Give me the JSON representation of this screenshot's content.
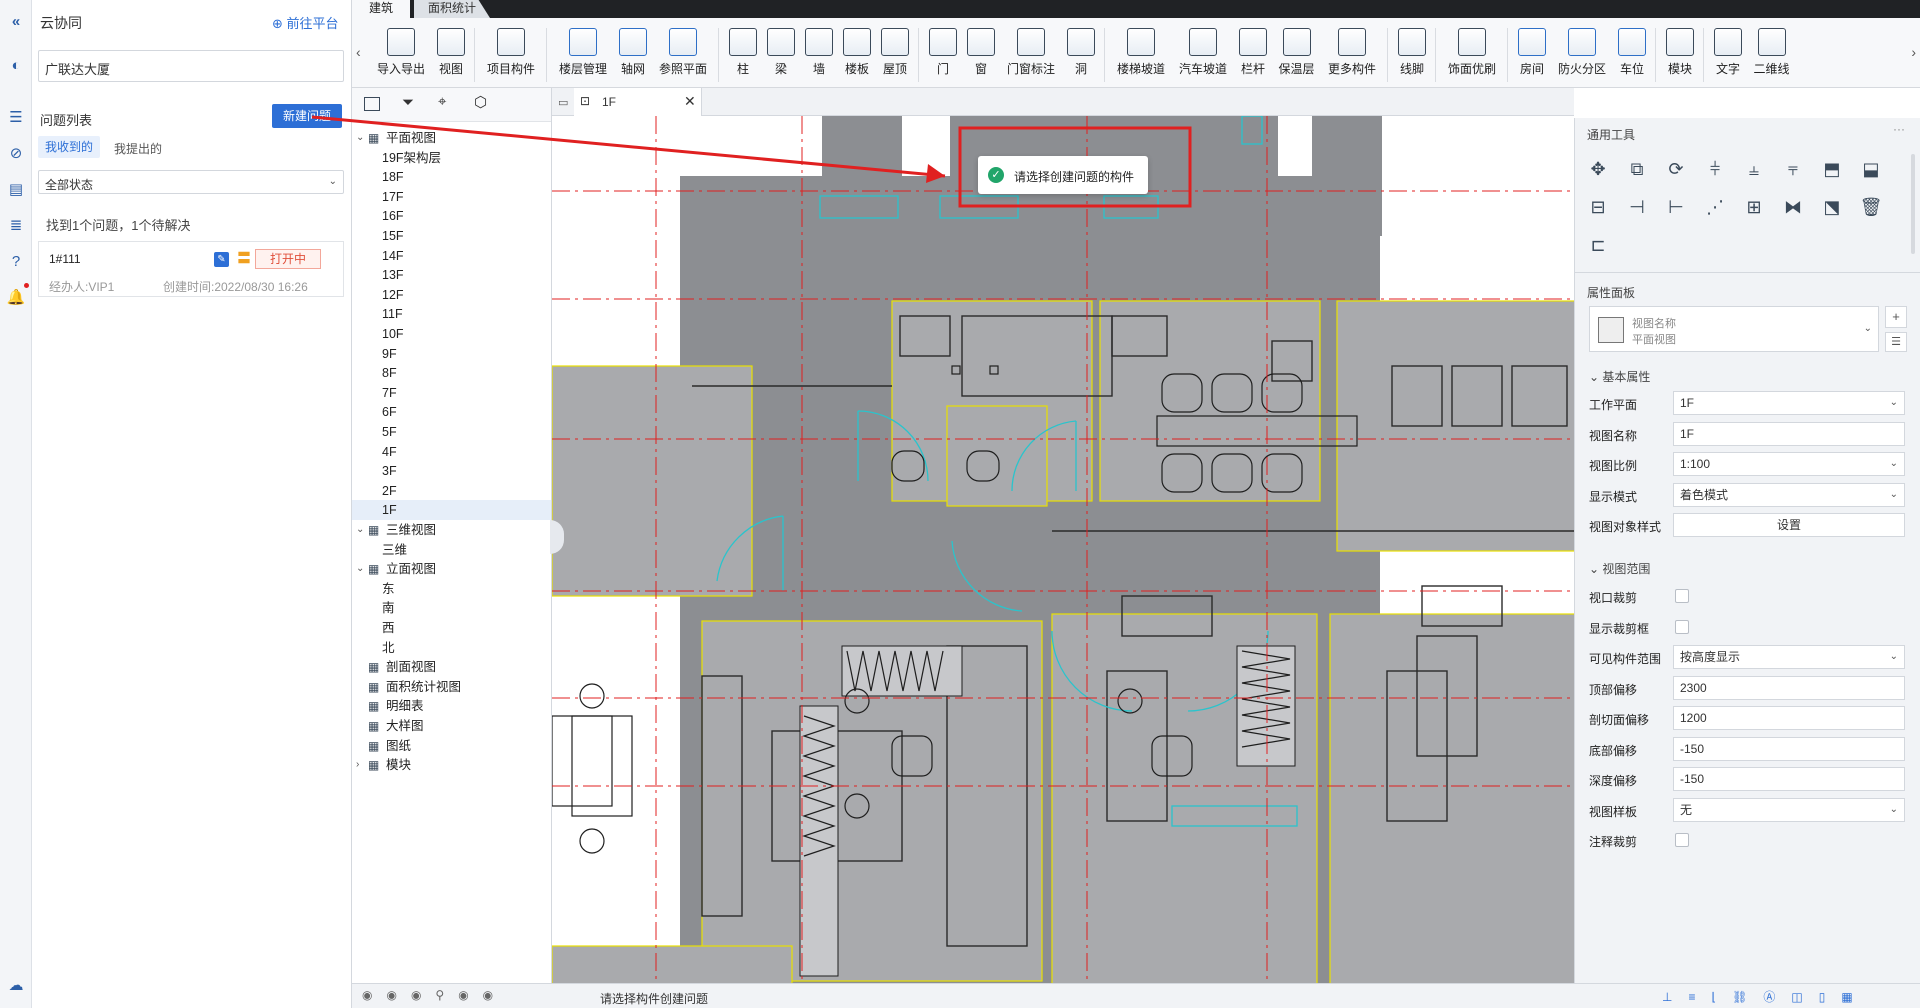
{
  "collab": {
    "title": "云协同",
    "platform_link": "前往平台",
    "project_name": "广联达大厦",
    "issue_list_label": "问题列表",
    "new_issue_button": "新建问题",
    "tabs": [
      "我收到的",
      "我提出的"
    ],
    "status_filter": "全部状态",
    "summary": "找到1个问题，1个待解决",
    "issue": {
      "id": "1#111",
      "status": "打开中",
      "assignee": "经办人:VIP1",
      "created": "创建时间:2022/08/30 16:26"
    }
  },
  "ribbon_tabs": [
    "建筑",
    "面积统计"
  ],
  "toolbar": {
    "groups": [
      [
        "导入导出",
        "视图"
      ],
      [
        "项目构件"
      ],
      [
        "楼层管理",
        "轴网",
        "参照平面"
      ],
      [
        "柱",
        "梁",
        "墙",
        "楼板",
        "屋顶"
      ],
      [
        "门",
        "窗",
        "门窗标注",
        "洞"
      ],
      [
        "楼梯坡道",
        "汽车坡道",
        "栏杆",
        "保温层",
        "更多构件"
      ],
      [
        "线脚"
      ],
      [
        "饰面优刷"
      ],
      [
        "房间",
        "防火分区",
        "车位"
      ],
      [
        "模块"
      ],
      [
        "文字",
        "二维线"
      ]
    ]
  },
  "tree": {
    "tab_label": "1F",
    "items": [
      {
        "label": "平面视图",
        "level": 0,
        "expanded": true
      },
      {
        "label": "19F架构层",
        "level": 1
      },
      {
        "label": "18F",
        "level": 1
      },
      {
        "label": "17F",
        "level": 1
      },
      {
        "label": "16F",
        "level": 1
      },
      {
        "label": "15F",
        "level": 1
      },
      {
        "label": "14F",
        "level": 1
      },
      {
        "label": "13F",
        "level": 1
      },
      {
        "label": "12F",
        "level": 1
      },
      {
        "label": "11F",
        "level": 1
      },
      {
        "label": "10F",
        "level": 1
      },
      {
        "label": "9F",
        "level": 1
      },
      {
        "label": "8F",
        "level": 1
      },
      {
        "label": "7F",
        "level": 1
      },
      {
        "label": "6F",
        "level": 1
      },
      {
        "label": "5F",
        "level": 1
      },
      {
        "label": "4F",
        "level": 1
      },
      {
        "label": "3F",
        "level": 1
      },
      {
        "label": "2F",
        "level": 1
      },
      {
        "label": "1F",
        "level": 1,
        "selected": true
      },
      {
        "label": "三维视图",
        "level": 0,
        "expanded": true
      },
      {
        "label": "三维",
        "level": 1
      },
      {
        "label": "立面视图",
        "level": 0,
        "expanded": true
      },
      {
        "label": "东",
        "level": 1
      },
      {
        "label": "南",
        "level": 1
      },
      {
        "label": "西",
        "level": 1
      },
      {
        "label": "北",
        "level": 1
      },
      {
        "label": "剖面视图",
        "level": 0
      },
      {
        "label": "面积统计视图",
        "level": 0
      },
      {
        "label": "明细表",
        "level": 0
      },
      {
        "label": "大样图",
        "level": 0
      },
      {
        "label": "图纸",
        "level": 0
      },
      {
        "label": "模块",
        "level": 0,
        "collapsed": true
      }
    ]
  },
  "toast": "请选择创建问题的构件",
  "tools": {
    "title": "通用工具"
  },
  "props": {
    "title": "属性面板",
    "view_name_label": "视图名称",
    "view_type": "平面视图",
    "basic_section": "基本属性",
    "range_section": "视图范围",
    "rows": [
      {
        "label": "工作平面",
        "value": "1F",
        "type": "select"
      },
      {
        "label": "视图名称",
        "value": "1F",
        "type": "input"
      },
      {
        "label": "视图比例",
        "value": "1:100",
        "type": "select"
      },
      {
        "label": "显示模式",
        "value": "着色模式",
        "type": "select"
      },
      {
        "label": "视图对象样式",
        "value": "设置",
        "type": "button"
      }
    ],
    "range_rows": [
      {
        "label": "视口裁剪",
        "type": "checkbox"
      },
      {
        "label": "显示裁剪框",
        "type": "checkbox"
      },
      {
        "label": "可见构件范围",
        "value": "按高度显示",
        "type": "select"
      },
      {
        "label": "顶部偏移",
        "value": "2300",
        "type": "input"
      },
      {
        "label": "剖切面偏移",
        "value": "1200",
        "type": "input"
      },
      {
        "label": "底部偏移",
        "value": "-150",
        "type": "input"
      },
      {
        "label": "深度偏移",
        "value": "-150",
        "type": "input"
      },
      {
        "label": "视图样板",
        "value": "无",
        "type": "select"
      },
      {
        "label": "注释裁剪",
        "type": "checkbox"
      }
    ]
  },
  "status": "请选择构件创建问题",
  "colors": {
    "accent": "#2d6fd6",
    "annotation": "#e02020",
    "status_open": "#e04f3a"
  }
}
